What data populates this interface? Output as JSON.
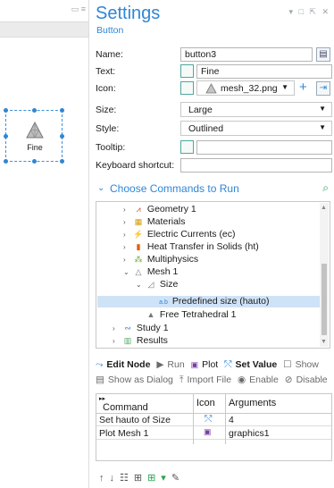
{
  "left_panel": {
    "window_icons": "▭ ≡",
    "canvas_button_label": "Fine"
  },
  "settings": {
    "title": "Settings",
    "subtitle": "Button",
    "header_icons": "▾ □ ⇱ ✕"
  },
  "form": {
    "name_label": "Name:",
    "name_value": "button3",
    "text_label": "Text:",
    "text_value": "Fine",
    "icon_label": "Icon:",
    "icon_value": "mesh_32.png",
    "size_label": "Size:",
    "size_value": "Large",
    "style_label": "Style:",
    "style_value": "Outlined",
    "tooltip_label": "Tooltip:",
    "tooltip_value": "",
    "shortcut_label": "Keyboard shortcut:",
    "shortcut_value": ""
  },
  "section": {
    "title": "Choose Commands to Run"
  },
  "tree": [
    {
      "label": "Geometry 1"
    },
    {
      "label": "Materials"
    },
    {
      "label": "Electric Currents (ec)"
    },
    {
      "label": "Heat Transfer in Solids (ht)"
    },
    {
      "label": "Multiphysics"
    },
    {
      "label": "Mesh 1"
    },
    {
      "label": "Size"
    },
    {
      "label": "Predefined size (hauto)"
    },
    {
      "label": "Free Tetrahedral 1"
    },
    {
      "label": "Study 1"
    },
    {
      "label": "Results"
    }
  ],
  "toolbar1": {
    "edit_node": "Edit Node",
    "run": "Run",
    "plot": "Plot",
    "set_value": "Set Value",
    "show": "Show"
  },
  "toolbar2": {
    "show_as_dialog": "Show as Dialog",
    "import_file": "Import File",
    "enable": "Enable",
    "disable": "Disable"
  },
  "table": {
    "headers": [
      "Command",
      "Icon",
      "Arguments"
    ],
    "rows": [
      {
        "command": "Set hauto of Size",
        "argument": "4"
      },
      {
        "command": "Plot Mesh 1",
        "argument": "graphics1"
      }
    ]
  },
  "colors": {
    "accent": "#2f86d6",
    "selection": "#cfe3f7"
  }
}
